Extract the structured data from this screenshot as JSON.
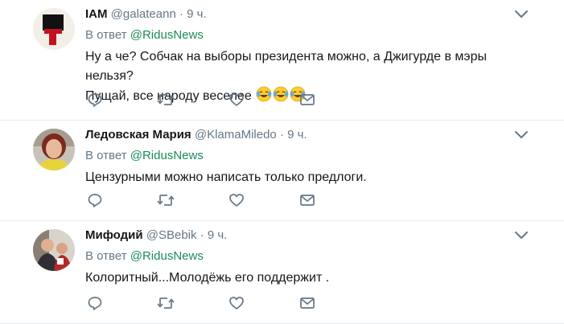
{
  "reply_prefix": "В ответ",
  "tweets": [
    {
      "name": "IAM",
      "handle": "@galateann",
      "dot": "·",
      "time": "9 ч.",
      "reply_to": "@RidusNews",
      "text_lines": [
        "Ну а че? Собчак на выборы президента можно, а Джигурде в мэры нельзя?",
        "Пущай, все народу веселее"
      ],
      "emoji": [
        "face-with-tears-of-joy",
        "face-with-tears-of-joy",
        "face-with-tears-of-joy"
      ]
    },
    {
      "name": "Ледовская Мария",
      "handle": "@KlamaMiledo",
      "dot": "·",
      "time": "9 ч.",
      "reply_to": "@RidusNews",
      "text_lines": [
        "Цензурными можно написать только предлоги."
      ]
    },
    {
      "name": "Мифодий",
      "handle": "@SBebik",
      "dot": "·",
      "time": "9 ч.",
      "reply_to": "@RidusNews",
      "text_lines": [
        "Колоритный...Молодёжь его поддержит ."
      ]
    }
  ],
  "icons": {
    "reply": "reply-icon",
    "retweet": "retweet-icon",
    "like": "heart-icon",
    "dm": "envelope-icon",
    "more": "chevron-down-icon"
  },
  "colors": {
    "icon_gray": "#657786",
    "link_green": "#1c8a5a",
    "divider": "#e6ecf0"
  }
}
